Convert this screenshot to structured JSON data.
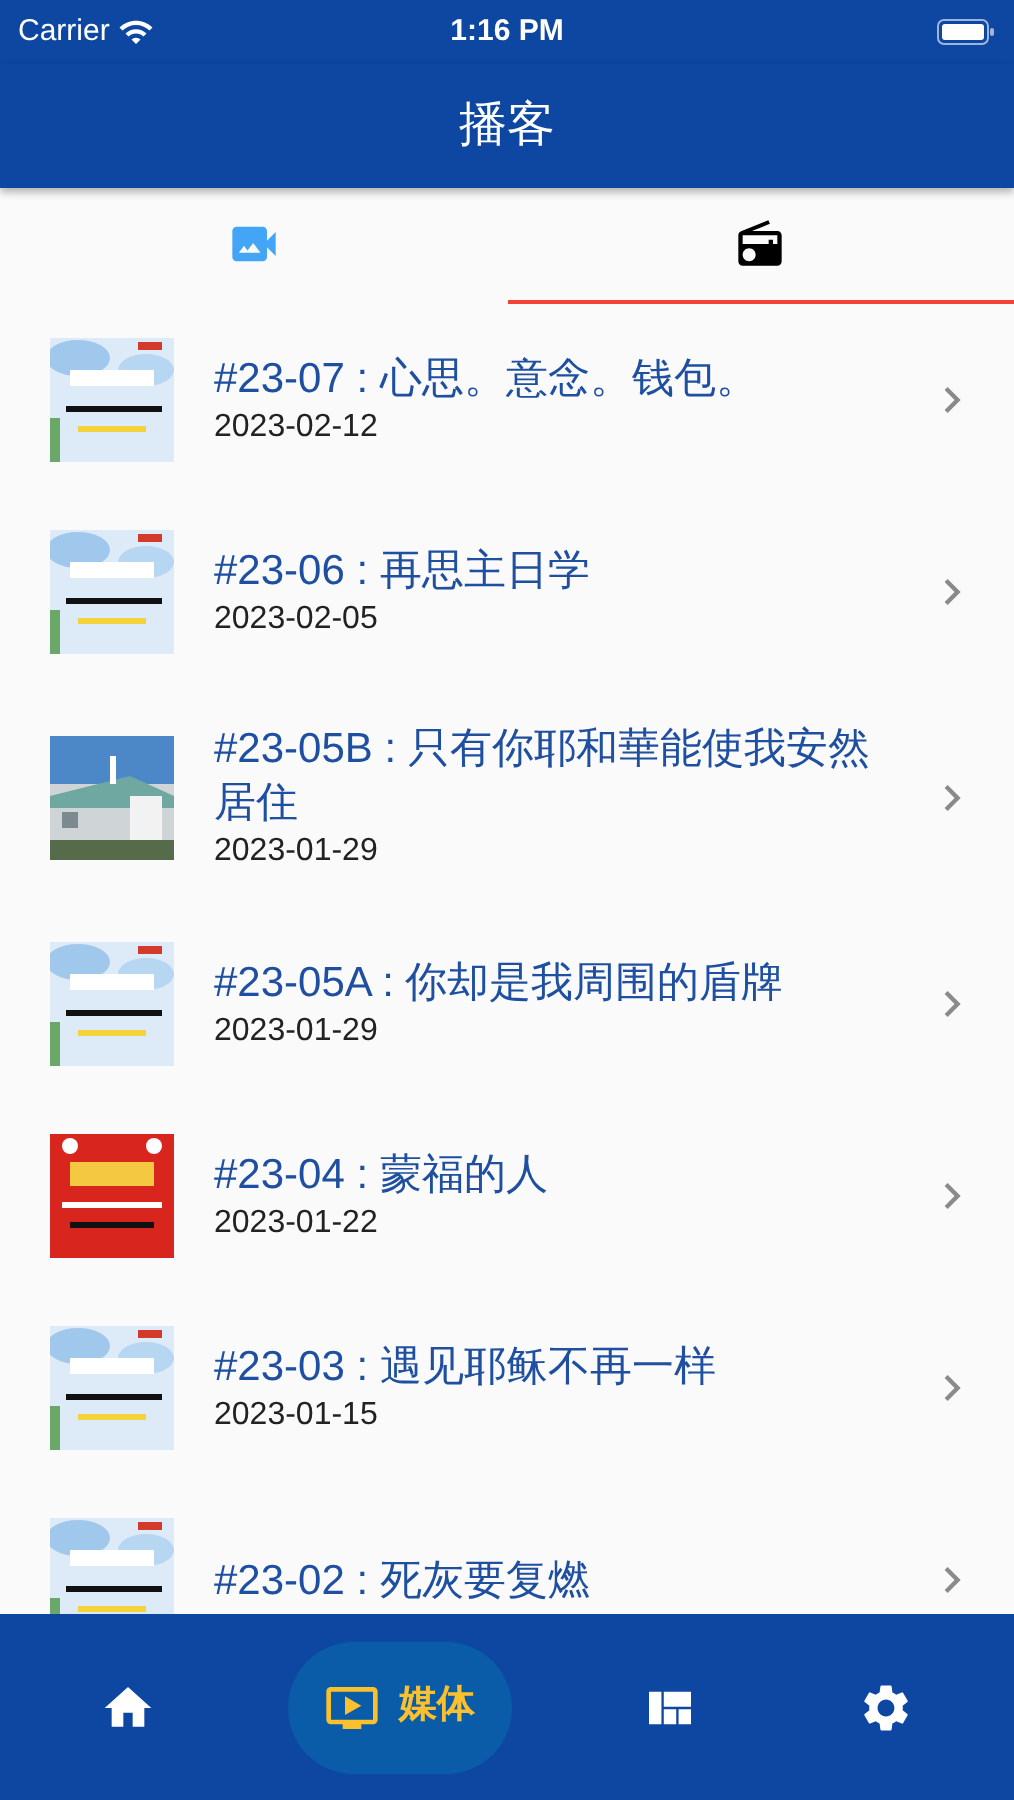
{
  "status_bar": {
    "carrier": "Carrier",
    "time": "1:16 PM"
  },
  "header": {
    "title": "播客"
  },
  "tabs": [
    {
      "kind": "video",
      "selected": false
    },
    {
      "kind": "radio",
      "selected": true
    }
  ],
  "episodes": [
    {
      "title": "#23-07 : 心思。意念。钱包。",
      "date": "2023-02-12"
    },
    {
      "title": "#23-06 : 再思主日学",
      "date": "2023-02-05"
    },
    {
      "title": "#23-05B : 只有你耶和華能使我安然居住",
      "date": "2023-01-29"
    },
    {
      "title": "#23-05A : 你却是我周围的盾牌",
      "date": "2023-01-29"
    },
    {
      "title": "#23-04 : 蒙福的人",
      "date": "2023-01-22"
    },
    {
      "title": "#23-03 : 遇见耶稣不再一样",
      "date": "2023-01-15"
    },
    {
      "title": "#23-02 : 死灰要复燃"
    }
  ],
  "bottom_nav": [
    {
      "kind": "home",
      "selected": false
    },
    {
      "kind": "media",
      "selected": true,
      "label": "媒体"
    },
    {
      "kind": "news",
      "selected": false
    },
    {
      "kind": "settings",
      "selected": false
    }
  ]
}
